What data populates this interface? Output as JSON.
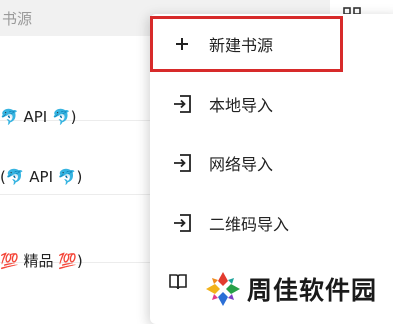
{
  "search": {
    "placeholder": "书源"
  },
  "list": {
    "rows": [
      {
        "label": "🐬 API 🐬)"
      },
      {
        "label": "(🐬 API 🐬)"
      },
      {
        "label": "💯 精品 💯)"
      }
    ]
  },
  "menu": {
    "items": [
      {
        "label": "新建书源",
        "icon": "plus-icon"
      },
      {
        "label": "本地导入",
        "icon": "import-icon"
      },
      {
        "label": "网络导入",
        "icon": "import-icon"
      },
      {
        "label": "二维码导入",
        "icon": "import-icon"
      },
      {
        "label": "",
        "icon": "book-icon"
      }
    ]
  },
  "watermark": {
    "text": "周佳软件园"
  },
  "colors": {
    "highlight": "#d72a2a",
    "search_bg": "#f1f1f1"
  }
}
